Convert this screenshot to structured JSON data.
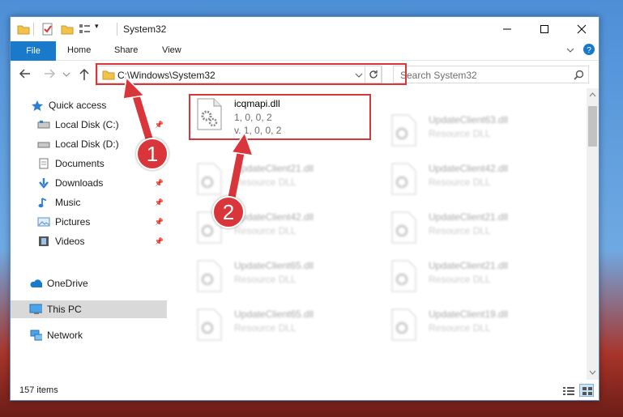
{
  "window": {
    "title": "System32",
    "quick_access_dropdown": "▾"
  },
  "ribbon": {
    "tabs": [
      "File",
      "Home",
      "Share",
      "View"
    ]
  },
  "address": {
    "path": "C:\\Windows\\System32",
    "search_placeholder": "Search System32"
  },
  "nav": {
    "items": [
      {
        "label": "Quick access",
        "icon": "star-icon",
        "pinned": false
      },
      {
        "label": "Local Disk (C:)",
        "icon": "drive-icon",
        "pinned": true
      },
      {
        "label": "Local Disk (D:)",
        "icon": "drive-icon",
        "pinned": false
      },
      {
        "label": "Documents",
        "icon": "documents-icon",
        "pinned": true
      },
      {
        "label": "Downloads",
        "icon": "download-icon",
        "pinned": true
      },
      {
        "label": "Music",
        "icon": "music-icon",
        "pinned": true
      },
      {
        "label": "Pictures",
        "icon": "pictures-icon",
        "pinned": true
      },
      {
        "label": "Videos",
        "icon": "videos-icon",
        "pinned": true
      },
      {
        "label": "OneDrive",
        "icon": "cloud-icon",
        "pinned": false
      },
      {
        "label": "This PC",
        "icon": "computer-icon",
        "pinned": false
      },
      {
        "label": "Network",
        "icon": "network-icon",
        "pinned": false
      }
    ]
  },
  "files": {
    "main": {
      "name": "icqmapi.dll",
      "line1": "1, 0, 0, 2",
      "line2": "v. 1, 0, 0, 2"
    },
    "left_col": [
      {
        "name": "UpdateClient21.dll",
        "sub": "Resource DLL"
      },
      {
        "name": "UpdateClient42.dll",
        "sub": "Resource DLL"
      },
      {
        "name": "UpdateClient65.dll",
        "sub": "Resource DLL"
      },
      {
        "name": "UpdateClient65.dll",
        "sub": "Resource DLL"
      }
    ],
    "right_col": [
      {
        "name": "UpdateClient63.dll",
        "sub": "Resource DLL"
      },
      {
        "name": "UpdateClient42.dll",
        "sub": "Resource DLL"
      },
      {
        "name": "UpdateClient21.dll",
        "sub": "Resource DLL"
      },
      {
        "name": "UpdateClient21.dll",
        "sub": "Resource DLL"
      },
      {
        "name": "UpdateClient19.dll",
        "sub": "Resource DLL"
      }
    ]
  },
  "status": {
    "count": "157 items"
  },
  "callouts": [
    "1",
    "2"
  ],
  "colors": {
    "accent": "#1979ca",
    "highlight": "#d9363b"
  }
}
